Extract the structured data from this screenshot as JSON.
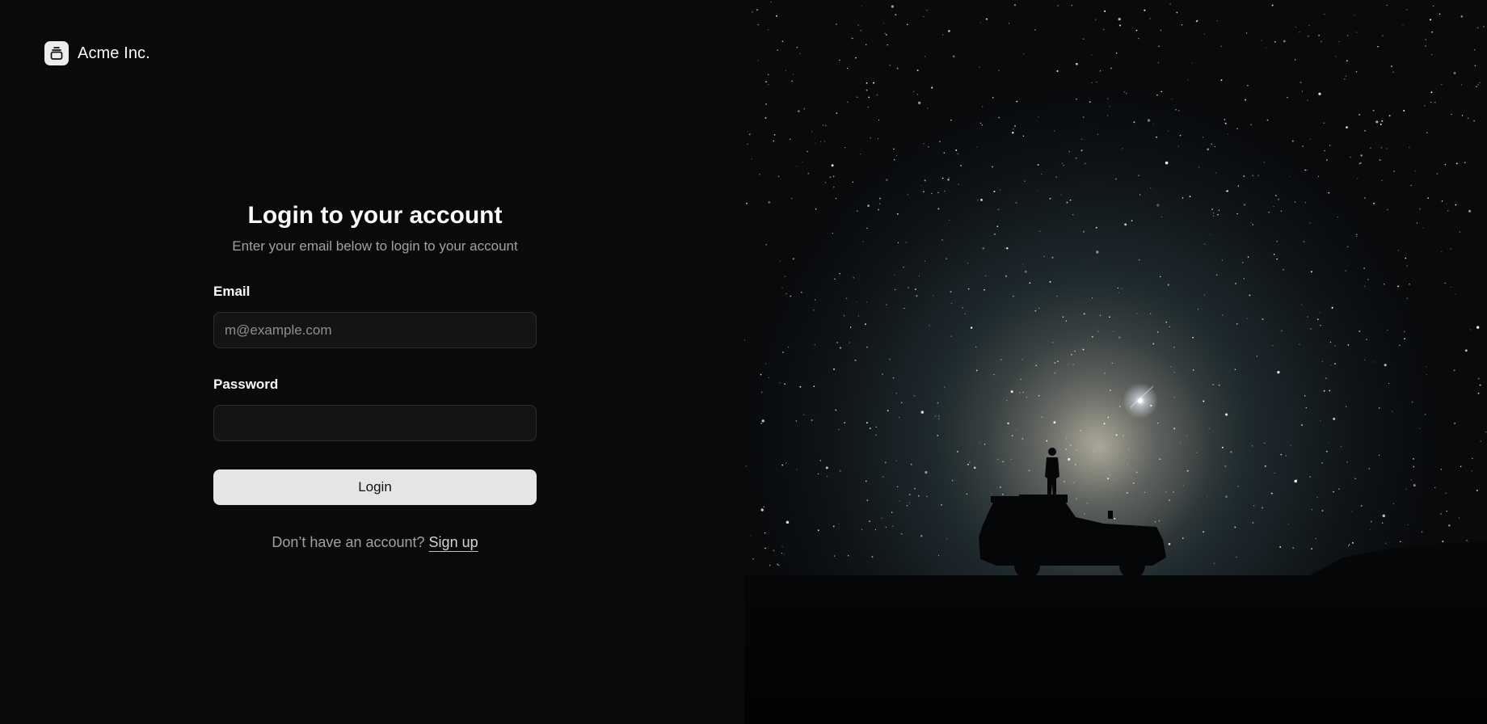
{
  "brand": {
    "name": "Acme Inc.",
    "logo_icon": "gallery-stack-icon"
  },
  "login_form": {
    "title": "Login to your account",
    "subtitle": "Enter your email below to login to your account",
    "email_label": "Email",
    "email_placeholder": "m@example.com",
    "email_value": "",
    "password_label": "Password",
    "password_value": "",
    "login_button_label": "Login",
    "signup_prompt": "Don’t have an account?",
    "signup_link_label": "Sign up"
  },
  "hero": {
    "image_subject": "night-sky-milky-way-person-on-vehicle"
  },
  "colors": {
    "background": "#0a0a0a",
    "input_background": "#141414",
    "input_border": "#2e2e2e",
    "button_background": "#e5e5e5",
    "muted_text": "#a1a1a1"
  }
}
